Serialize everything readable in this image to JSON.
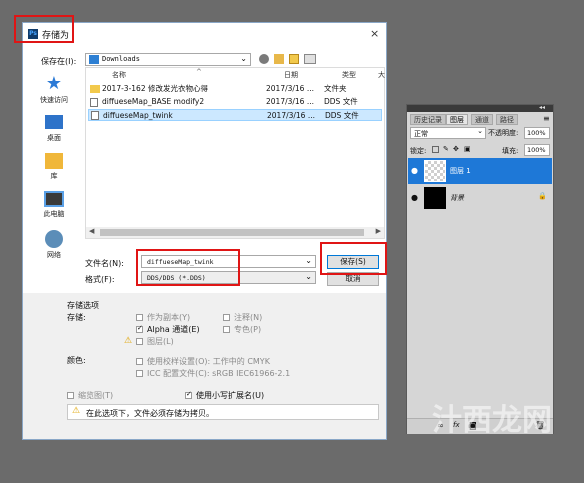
{
  "dialog": {
    "title": "存储为",
    "app_icon": "Ps",
    "close_glyph": "×",
    "save_in_label": "保存在(I):",
    "location": "Downloads",
    "sidebar": [
      {
        "label": "快速访问",
        "icon": "star-icon"
      },
      {
        "label": "桌面",
        "icon": "desktop-icon"
      },
      {
        "label": "库",
        "icon": "library-icon"
      },
      {
        "label": "此电脑",
        "icon": "computer-icon"
      },
      {
        "label": "网络",
        "icon": "network-icon"
      }
    ],
    "columns": {
      "name": "名称",
      "date": "日期",
      "type": "类型",
      "size": "大"
    },
    "files": [
      {
        "name": "2017-3-162 修改发光衣物心得",
        "date": "2017/3/16 ...",
        "type": "文件夹",
        "icon": "folder-icon"
      },
      {
        "name": "diffueseMap_BASE modify2",
        "date": "2017/3/16 ...",
        "type": "DDS 文件",
        "icon": "file-icon"
      },
      {
        "name": "diffueseMap_twink",
        "date": "2017/3/16 ...",
        "type": "DDS 文件",
        "icon": "file-icon",
        "selected": true
      }
    ],
    "filename_label": "文件名(N):",
    "filename_value": "diffueseMap_twink",
    "format_label": "格式(F):",
    "format_value": "DDS/DDS (*.DDS)",
    "save_button": "保存(S)",
    "cancel_button": "取消",
    "save_options_label": "存储选项",
    "storage_label": "存储:",
    "opt_copy": "作为副本(Y)",
    "opt_alpha": "Alpha 通道(E)",
    "opt_layers": "图层(L)",
    "opt_notes": "注释(N)",
    "opt_spot": "专色(P)",
    "color_label": "颜色:",
    "opt_proof": "使用校样设置(O): 工作中的 CMYK",
    "opt_icc": "ICC 配置文件(C): sRGB IEC61966-2.1",
    "opt_thumb": "缩览图(T)",
    "opt_lower_ext": "使用小写扩展名(U)",
    "warning": "在此选项下，文件必须存储为拷贝。"
  },
  "layers_panel": {
    "tabs": [
      "历史记录",
      "图层",
      "通道",
      "路径"
    ],
    "blend_mode": "正常",
    "opacity_label": "不透明度:",
    "opacity_value": "100%",
    "lock_label": "锁定:",
    "fill_label": "填充:",
    "fill_value": "100%",
    "layers": [
      {
        "name": "图层 1",
        "selected": true
      },
      {
        "name": "背景",
        "selected": false
      }
    ]
  },
  "watermark": "汁西龙网"
}
